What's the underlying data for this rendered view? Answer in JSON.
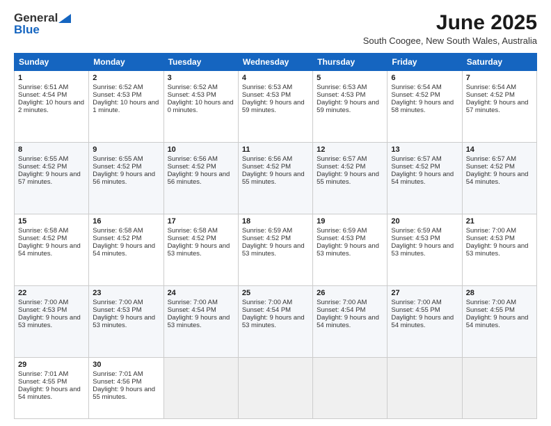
{
  "header": {
    "logo_general": "General",
    "logo_blue": "Blue",
    "month_year": "June 2025",
    "location": "South Coogee, New South Wales, Australia"
  },
  "days_header": [
    "Sunday",
    "Monday",
    "Tuesday",
    "Wednesday",
    "Thursday",
    "Friday",
    "Saturday"
  ],
  "weeks": [
    [
      {
        "day": "1",
        "sunrise": "Sunrise: 6:51 AM",
        "sunset": "Sunset: 4:54 PM",
        "daylight": "Daylight: 10 hours and 2 minutes."
      },
      {
        "day": "2",
        "sunrise": "Sunrise: 6:52 AM",
        "sunset": "Sunset: 4:53 PM",
        "daylight": "Daylight: 10 hours and 1 minute."
      },
      {
        "day": "3",
        "sunrise": "Sunrise: 6:52 AM",
        "sunset": "Sunset: 4:53 PM",
        "daylight": "Daylight: 10 hours and 0 minutes."
      },
      {
        "day": "4",
        "sunrise": "Sunrise: 6:53 AM",
        "sunset": "Sunset: 4:53 PM",
        "daylight": "Daylight: 9 hours and 59 minutes."
      },
      {
        "day": "5",
        "sunrise": "Sunrise: 6:53 AM",
        "sunset": "Sunset: 4:53 PM",
        "daylight": "Daylight: 9 hours and 59 minutes."
      },
      {
        "day": "6",
        "sunrise": "Sunrise: 6:54 AM",
        "sunset": "Sunset: 4:52 PM",
        "daylight": "Daylight: 9 hours and 58 minutes."
      },
      {
        "day": "7",
        "sunrise": "Sunrise: 6:54 AM",
        "sunset": "Sunset: 4:52 PM",
        "daylight": "Daylight: 9 hours and 57 minutes."
      }
    ],
    [
      {
        "day": "8",
        "sunrise": "Sunrise: 6:55 AM",
        "sunset": "Sunset: 4:52 PM",
        "daylight": "Daylight: 9 hours and 57 minutes."
      },
      {
        "day": "9",
        "sunrise": "Sunrise: 6:55 AM",
        "sunset": "Sunset: 4:52 PM",
        "daylight": "Daylight: 9 hours and 56 minutes."
      },
      {
        "day": "10",
        "sunrise": "Sunrise: 6:56 AM",
        "sunset": "Sunset: 4:52 PM",
        "daylight": "Daylight: 9 hours and 56 minutes."
      },
      {
        "day": "11",
        "sunrise": "Sunrise: 6:56 AM",
        "sunset": "Sunset: 4:52 PM",
        "daylight": "Daylight: 9 hours and 55 minutes."
      },
      {
        "day": "12",
        "sunrise": "Sunrise: 6:57 AM",
        "sunset": "Sunset: 4:52 PM",
        "daylight": "Daylight: 9 hours and 55 minutes."
      },
      {
        "day": "13",
        "sunrise": "Sunrise: 6:57 AM",
        "sunset": "Sunset: 4:52 PM",
        "daylight": "Daylight: 9 hours and 54 minutes."
      },
      {
        "day": "14",
        "sunrise": "Sunrise: 6:57 AM",
        "sunset": "Sunset: 4:52 PM",
        "daylight": "Daylight: 9 hours and 54 minutes."
      }
    ],
    [
      {
        "day": "15",
        "sunrise": "Sunrise: 6:58 AM",
        "sunset": "Sunset: 4:52 PM",
        "daylight": "Daylight: 9 hours and 54 minutes."
      },
      {
        "day": "16",
        "sunrise": "Sunrise: 6:58 AM",
        "sunset": "Sunset: 4:52 PM",
        "daylight": "Daylight: 9 hours and 54 minutes."
      },
      {
        "day": "17",
        "sunrise": "Sunrise: 6:58 AM",
        "sunset": "Sunset: 4:52 PM",
        "daylight": "Daylight: 9 hours and 53 minutes."
      },
      {
        "day": "18",
        "sunrise": "Sunrise: 6:59 AM",
        "sunset": "Sunset: 4:52 PM",
        "daylight": "Daylight: 9 hours and 53 minutes."
      },
      {
        "day": "19",
        "sunrise": "Sunrise: 6:59 AM",
        "sunset": "Sunset: 4:53 PM",
        "daylight": "Daylight: 9 hours and 53 minutes."
      },
      {
        "day": "20",
        "sunrise": "Sunrise: 6:59 AM",
        "sunset": "Sunset: 4:53 PM",
        "daylight": "Daylight: 9 hours and 53 minutes."
      },
      {
        "day": "21",
        "sunrise": "Sunrise: 7:00 AM",
        "sunset": "Sunset: 4:53 PM",
        "daylight": "Daylight: 9 hours and 53 minutes."
      }
    ],
    [
      {
        "day": "22",
        "sunrise": "Sunrise: 7:00 AM",
        "sunset": "Sunset: 4:53 PM",
        "daylight": "Daylight: 9 hours and 53 minutes."
      },
      {
        "day": "23",
        "sunrise": "Sunrise: 7:00 AM",
        "sunset": "Sunset: 4:53 PM",
        "daylight": "Daylight: 9 hours and 53 minutes."
      },
      {
        "day": "24",
        "sunrise": "Sunrise: 7:00 AM",
        "sunset": "Sunset: 4:54 PM",
        "daylight": "Daylight: 9 hours and 53 minutes."
      },
      {
        "day": "25",
        "sunrise": "Sunrise: 7:00 AM",
        "sunset": "Sunset: 4:54 PM",
        "daylight": "Daylight: 9 hours and 53 minutes."
      },
      {
        "day": "26",
        "sunrise": "Sunrise: 7:00 AM",
        "sunset": "Sunset: 4:54 PM",
        "daylight": "Daylight: 9 hours and 54 minutes."
      },
      {
        "day": "27",
        "sunrise": "Sunrise: 7:00 AM",
        "sunset": "Sunset: 4:55 PM",
        "daylight": "Daylight: 9 hours and 54 minutes."
      },
      {
        "day": "28",
        "sunrise": "Sunrise: 7:00 AM",
        "sunset": "Sunset: 4:55 PM",
        "daylight": "Daylight: 9 hours and 54 minutes."
      }
    ],
    [
      {
        "day": "29",
        "sunrise": "Sunrise: 7:01 AM",
        "sunset": "Sunset: 4:55 PM",
        "daylight": "Daylight: 9 hours and 54 minutes."
      },
      {
        "day": "30",
        "sunrise": "Sunrise: 7:01 AM",
        "sunset": "Sunset: 4:56 PM",
        "daylight": "Daylight: 9 hours and 55 minutes."
      },
      null,
      null,
      null,
      null,
      null
    ]
  ]
}
